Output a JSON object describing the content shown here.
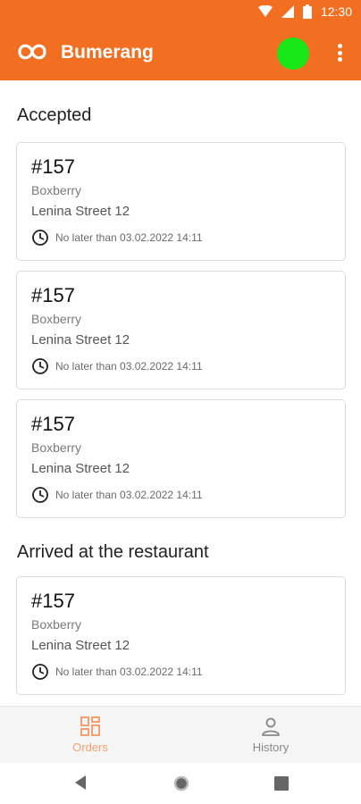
{
  "status_bar": {
    "time": "12:30"
  },
  "app_bar": {
    "title": "Bumerang"
  },
  "sections": [
    {
      "title": "Accepted",
      "orders": [
        {
          "number": "#157",
          "restaurant": "Boxberry",
          "address": "Lenina Street 12",
          "deadline": "No later than 03.02.2022 14:11"
        },
        {
          "number": "#157",
          "restaurant": "Boxberry",
          "address": "Lenina Street 12",
          "deadline": "No later than 03.02.2022 14:11"
        },
        {
          "number": "#157",
          "restaurant": "Boxberry",
          "address": "Lenina Street 12",
          "deadline": "No later than 03.02.2022 14:11"
        }
      ]
    },
    {
      "title": "Arrived at the restaurant",
      "orders": [
        {
          "number": "#157",
          "restaurant": "Boxberry",
          "address": "Lenina Street 12",
          "deadline": "No later than 03.02.2022 14:11"
        }
      ]
    }
  ],
  "bottom_nav": [
    {
      "label": "Orders",
      "icon": "orders-grid-icon",
      "active": true
    },
    {
      "label": "History",
      "icon": "person-icon",
      "active": false
    }
  ],
  "colors": {
    "primary": "#f26f21",
    "online": "#18e818",
    "active_nav": "#f5a070",
    "inactive_nav": "#888888"
  }
}
